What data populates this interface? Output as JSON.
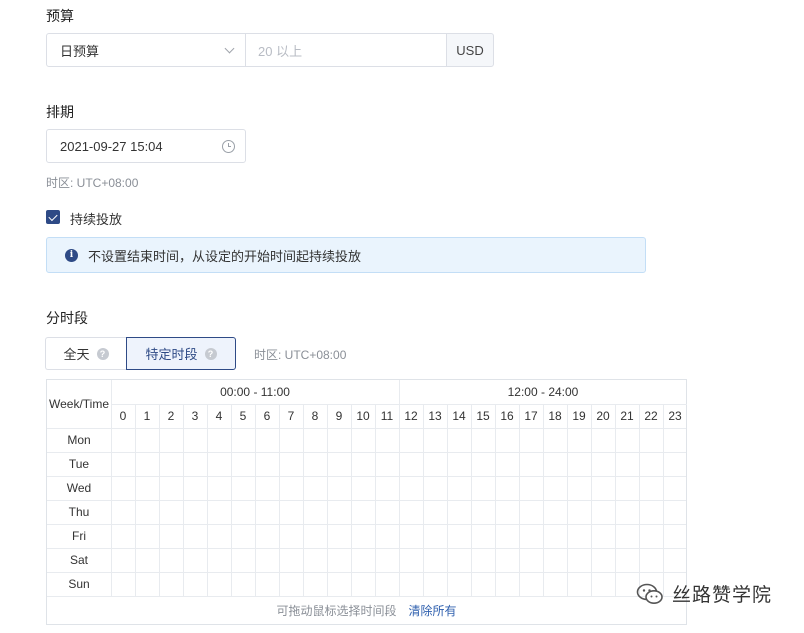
{
  "budget": {
    "label": "预算",
    "type_value": "日预算",
    "amount_placeholder": "20 以上",
    "currency": "USD"
  },
  "schedule": {
    "label": "排期",
    "start_datetime": "2021-09-27 15:04",
    "timezone_note": "时区: UTC+08:00",
    "continuous_label": "持续投放",
    "continuous_checked": true,
    "info_message": "不设置结束时间，从设定的开始时间起持续投放"
  },
  "dayparting": {
    "label": "分时段",
    "options": [
      "全天",
      "特定时段"
    ],
    "selected": "特定时段",
    "timezone_note": "时区: UTC+08:00",
    "table": {
      "corner_header": "Week/Time",
      "range_headers": [
        "00:00 - 11:00",
        "12:00 - 24:00"
      ],
      "hours": [
        "0",
        "1",
        "2",
        "3",
        "4",
        "5",
        "6",
        "7",
        "8",
        "9",
        "10",
        "11",
        "12",
        "13",
        "14",
        "15",
        "16",
        "17",
        "18",
        "19",
        "20",
        "21",
        "22",
        "23"
      ],
      "days": [
        "Mon",
        "Tue",
        "Wed",
        "Thu",
        "Fri",
        "Sat",
        "Sun"
      ],
      "footer_hint": "可拖动鼠标选择时间段",
      "clear_all": "清除所有"
    }
  },
  "watermark": {
    "text": "丝路赞学院",
    "icon": "wechat-icon"
  },
  "colors": {
    "accent": "#2e4a86",
    "border": "#dcdfe6",
    "info_bg": "#eaf4fd",
    "link": "#2e5fae"
  }
}
